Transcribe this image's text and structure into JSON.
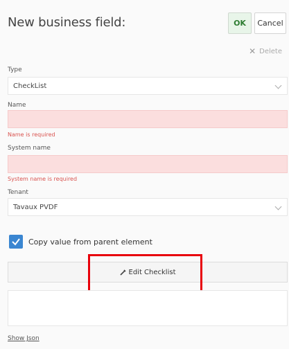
{
  "header": {
    "title": "New business field:",
    "ok_label": "OK",
    "cancel_label": "Cancel",
    "delete_label": "Delete"
  },
  "form": {
    "type": {
      "label": "Type",
      "value": "CheckList"
    },
    "name": {
      "label": "Name",
      "value": "",
      "error": "Name is required"
    },
    "system_name": {
      "label": "System name",
      "value": "",
      "error": "System name is required"
    },
    "tenant": {
      "label": "Tenant",
      "value": "Tavaux PVDF"
    },
    "copy_from_parent": {
      "label": "Copy value from parent element",
      "checked": true
    },
    "edit_checklist_label": "Edit Checklist",
    "show_json_label": "Show Json"
  },
  "colors": {
    "error_text": "#d9534f",
    "error_field_bg": "#fbdede",
    "checkbox": "#3a86d1",
    "highlight": "#e8000b"
  }
}
